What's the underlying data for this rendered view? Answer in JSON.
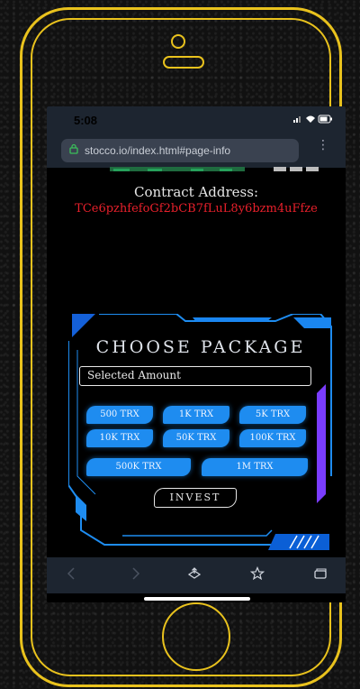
{
  "status_bar": {
    "time": "5:08"
  },
  "browser": {
    "url": "stocco.io/index.html#page-info"
  },
  "page": {
    "contract_label": "Contract Address:",
    "contract_address": "TCe6pzhfefoGf2bCB7fLuL8y6bzm4uFfze"
  },
  "package_panel": {
    "title": "CHOOSE PACKAGE",
    "amount_placeholder": "Selected Amount",
    "packages": [
      "500 TRX",
      "1K TRX",
      "5K TRX",
      "10K TRX",
      "50K TRX",
      "100K TRX",
      "500K TRX",
      "1M TRX"
    ],
    "invest_label": "INVEST"
  },
  "colors": {
    "frame": "#e9c21d",
    "accent_blue": "#1e8cf0",
    "address_red": "#e8202b",
    "panel_purple": "#7a3cff"
  },
  "icons": [
    "lock-icon",
    "more-icon",
    "back-icon",
    "forward-icon",
    "share-icon",
    "star-icon",
    "tabs-icon"
  ]
}
